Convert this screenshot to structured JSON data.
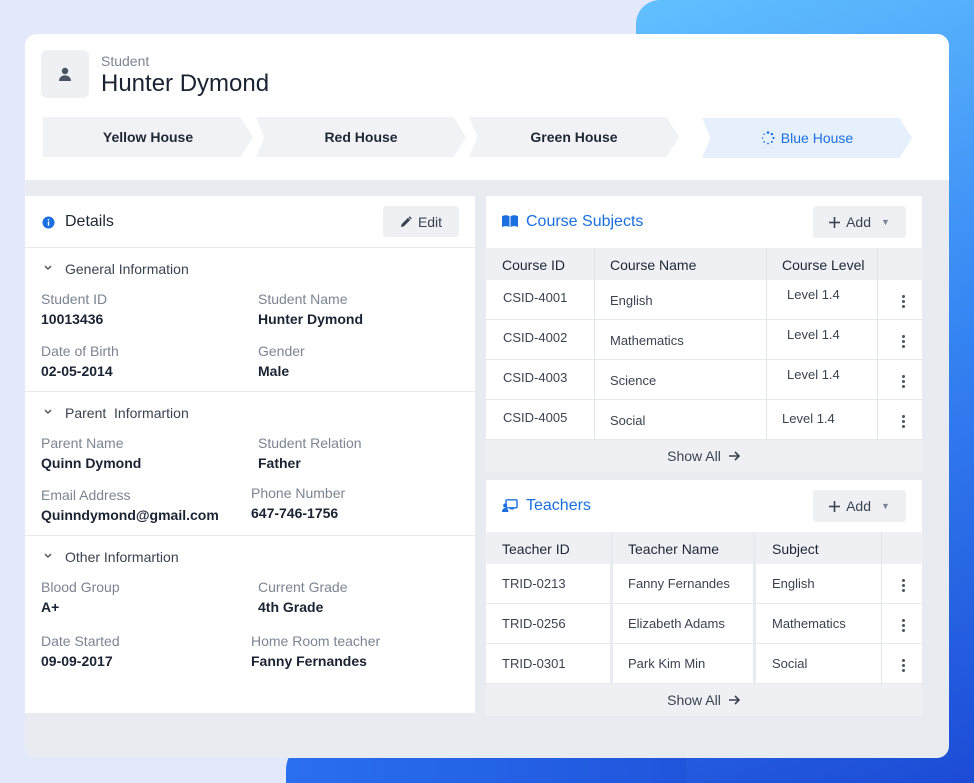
{
  "header": {
    "role": "Student",
    "name": "Hunter Dymond",
    "houses": [
      "Yellow House",
      "Red House",
      "Green House",
      "Blue House"
    ]
  },
  "details": {
    "title": "Details",
    "edit_label": "Edit",
    "general": {
      "title": "General Information",
      "student_id_label": "Student ID",
      "student_id": "10013436",
      "student_name_label": "Student Name",
      "student_name": "Hunter Dymond",
      "dob_label": "Date of Birth",
      "dob": "02-05-2014",
      "gender_label": "Gender",
      "gender": "Male"
    },
    "parent": {
      "title": "Parent  Informartion",
      "parent_name_label": "Parent Name",
      "parent_name": "Quinn Dymond",
      "relation_label": "Student Relation",
      "relation": "Father",
      "email_label": "Email Address",
      "email": "Quinndymond@gmail.com",
      "phone_label": "Phone Number",
      "phone": "647-746-1756"
    },
    "other": {
      "title": "Other Informartion",
      "blood_label": "Blood Group",
      "blood": "A+",
      "grade_label": "Current Grade",
      "grade": "4th Grade",
      "started_label": "Date Started",
      "started": "09-09-2017",
      "homeroom_label": "Home Room teacher",
      "homeroom": "Fanny Fernandes"
    }
  },
  "courses": {
    "title": "Course Subjects",
    "add_label": "Add",
    "columns": [
      "Course ID",
      "Course Name",
      "Course Level"
    ],
    "rows": [
      {
        "id": "CSID-4001",
        "name": "English",
        "level": "Level 1.4"
      },
      {
        "id": "CSID-4002",
        "name": "Mathematics",
        "level": "Level 1.4"
      },
      {
        "id": "CSID-4003",
        "name": "Science",
        "level": "Level 1.4"
      },
      {
        "id": "CSID-4005",
        "name": "Social",
        "level": "Level 1.4"
      }
    ],
    "show_all": "Show All"
  },
  "teachers": {
    "title": "Teachers",
    "add_label": "Add",
    "columns": [
      "Teacher ID",
      "Teacher Name",
      "Subject"
    ],
    "rows": [
      {
        "id": "TRID-0213",
        "name": "Fanny Fernandes",
        "subject": "English"
      },
      {
        "id": "TRID-0256",
        "name": "Elizabeth Adams",
        "subject": "Mathematics"
      },
      {
        "id": "TRID-0301",
        "name": "Park Kim Min",
        "subject": "Social"
      }
    ],
    "show_all": "Show All"
  },
  "colors": {
    "accent": "#1b6fe0",
    "background": "#e4e8fb"
  }
}
